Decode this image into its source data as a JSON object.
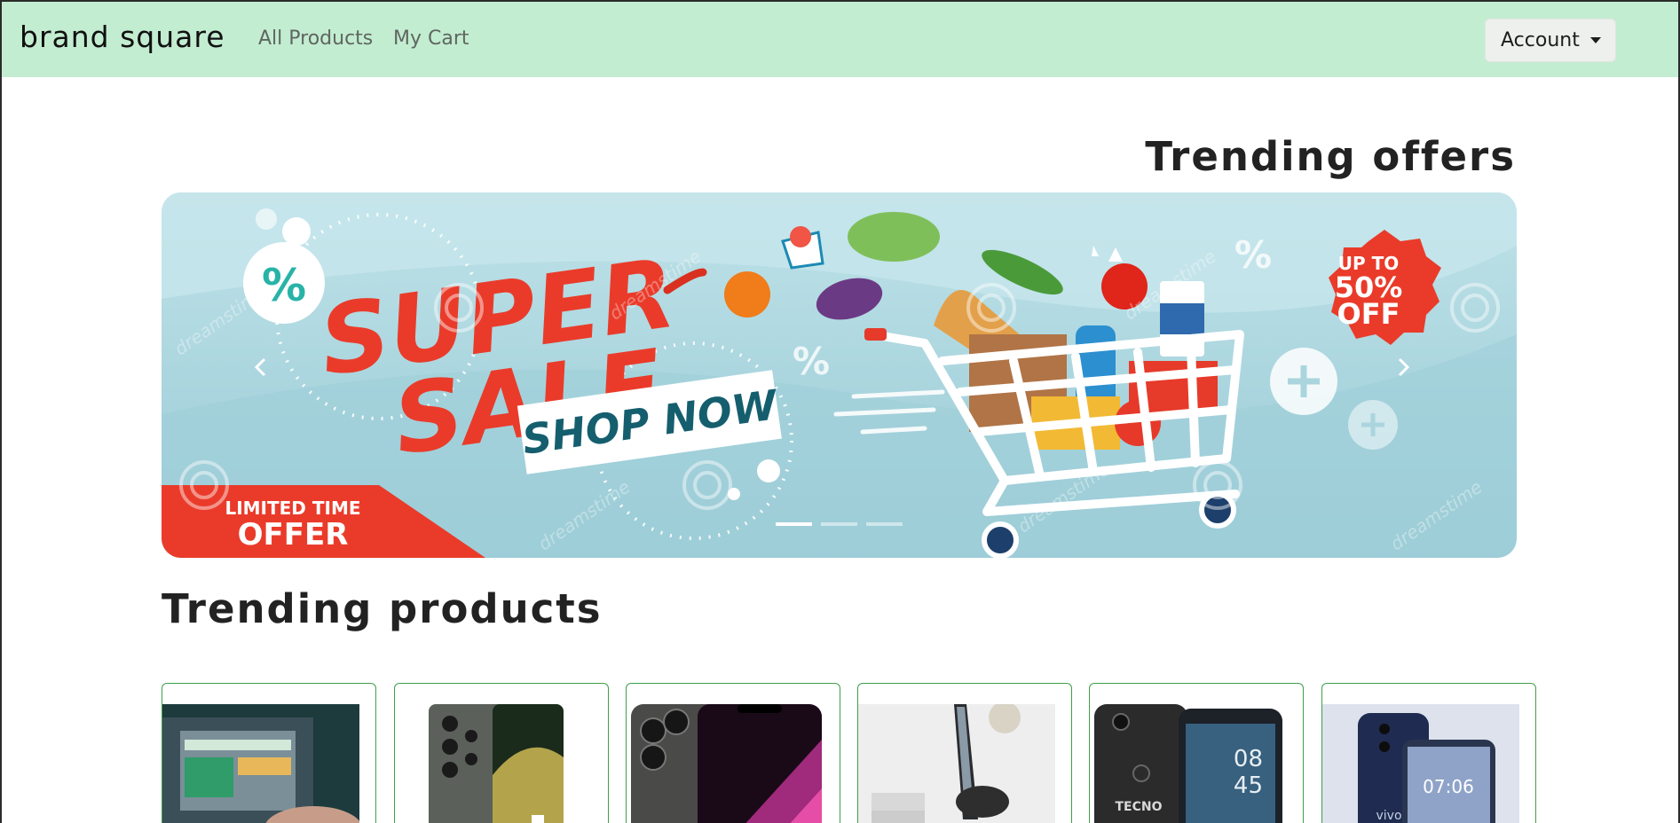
{
  "navbar": {
    "brand": "brand square",
    "links": [
      "All Products",
      "My Cart"
    ],
    "account_label": "Account",
    "background": "#c3edd1"
  },
  "offers": {
    "heading": "Trending offers",
    "slide": {
      "title_line1": "SUPER",
      "title_line2": "SALE",
      "cta": "SHOP NOW",
      "badge_line1": "UP TO",
      "badge_line2": "50%",
      "badge_line3": "OFF",
      "corner_line1": "LIMITED TIME",
      "corner_line2": "OFFER",
      "watermark": "dreamstime",
      "percent_symbol": "%"
    },
    "indicator_count": 3,
    "active_indicator": 0,
    "prev_icon": "chevron-left-icon",
    "next_icon": "chevron-right-icon",
    "accent_red": "#ea3b2a",
    "accent_teal": "#155e6e"
  },
  "products": {
    "heading": "Trending products",
    "items": [
      {
        "image": "laptop-screen-photo"
      },
      {
        "image": "samsung-galaxy-photo"
      },
      {
        "image": "iphone-photo"
      },
      {
        "image": "phone-stand-photo"
      },
      {
        "image": "tecno-phone-photo",
        "image_text": "TECNO",
        "screen_time_h": "08",
        "screen_time_m": "45"
      },
      {
        "image": "vivo-phone-photo",
        "image_text": "vivo",
        "screen_time": "07:06"
      }
    ],
    "card_border_color": "#3fa04a"
  }
}
